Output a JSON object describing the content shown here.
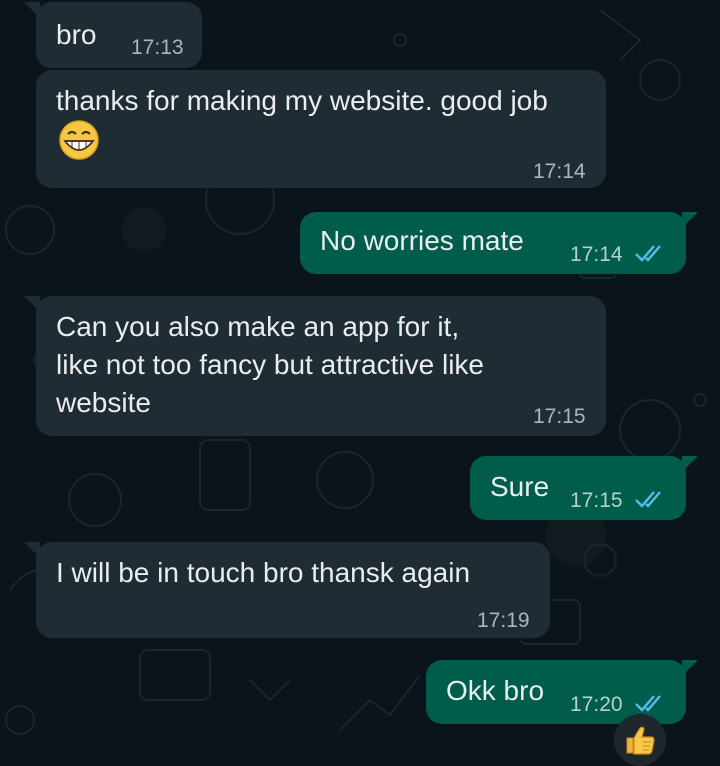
{
  "messages": [
    {
      "id": 1,
      "direction": "incoming",
      "text": "bro",
      "time": "17:13"
    },
    {
      "id": 2,
      "direction": "incoming",
      "text": "thanks for making my website. good job",
      "emoji": "grinning-face-emoji",
      "time": "17:14"
    },
    {
      "id": 3,
      "direction": "outgoing",
      "text": "No worries mate",
      "time": "17:14",
      "status": "read"
    },
    {
      "id": 4,
      "direction": "incoming",
      "text": "Can you also make an app for it,\nlike not too fancy but attractive like\nwebsite",
      "time": "17:15"
    },
    {
      "id": 5,
      "direction": "outgoing",
      "text": "Sure",
      "time": "17:15",
      "status": "read"
    },
    {
      "id": 6,
      "direction": "incoming",
      "text": "I will be in touch bro thansk again",
      "time": "17:19"
    },
    {
      "id": 7,
      "direction": "outgoing",
      "text": "Okk bro",
      "time": "17:20",
      "status": "read",
      "reaction": "thumbs-up-emoji"
    }
  ],
  "colors": {
    "background": "#0b141a",
    "incoming_bubble": "#202c33",
    "outgoing_bubble": "#005c4b",
    "text": "#e9edef",
    "read_ticks": "#53bdeb"
  }
}
